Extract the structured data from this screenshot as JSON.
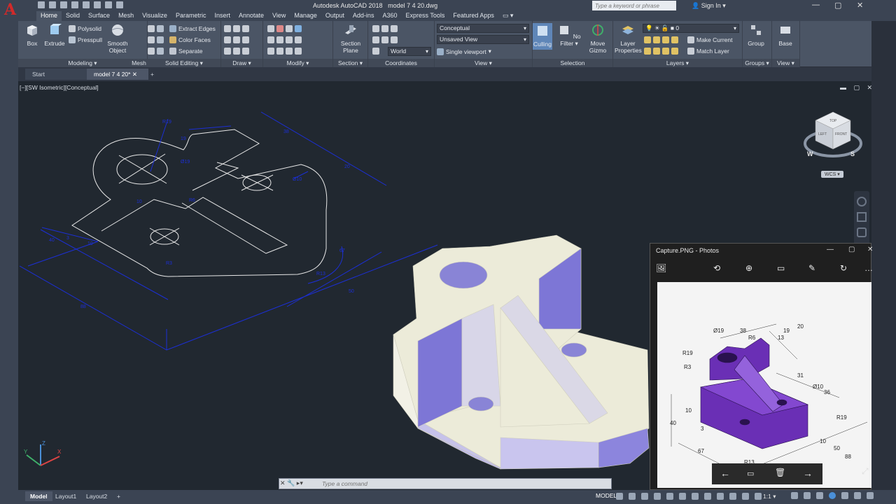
{
  "titlebar": {
    "app_name": "Autodesk AutoCAD 2018",
    "file_name": "model 7 4 20.dwg",
    "search_placeholder": "Type a keyword or phrase",
    "signin": "Sign In"
  },
  "ribbon_tabs": [
    "Home",
    "Solid",
    "Surface",
    "Mesh",
    "Visualize",
    "Parametric",
    "Insert",
    "Annotate",
    "View",
    "Manage",
    "Output",
    "Add-ins",
    "A360",
    "Express Tools",
    "Featured Apps"
  ],
  "panels": {
    "modeling": {
      "title": "Modeling",
      "box": "Box",
      "extrude": "Extrude",
      "polysolid": "Polysolid",
      "presspull": "Presspull",
      "smooth_object_1": "Smooth",
      "smooth_object_2": "Object"
    },
    "mesh": {
      "title": "Mesh"
    },
    "solid_editing": {
      "title": "Solid Editing",
      "extract_edges": "Extract Edges",
      "color_faces": "Color Faces",
      "separate": "Separate"
    },
    "draw": {
      "title": "Draw"
    },
    "modify": {
      "title": "Modify"
    },
    "section": {
      "title": "Section",
      "section_plane_1": "Section",
      "section_plane_2": "Plane"
    },
    "coordinates": {
      "title": "Coordinates",
      "world": "World"
    },
    "view": {
      "title": "View",
      "visual_style": "Conceptual",
      "named_view": "Unsaved View",
      "viewport_config": "Single viewport"
    },
    "selection": {
      "title": "Selection",
      "culling": "Culling",
      "no_filter": "No Filter",
      "move_gizmo_1": "Move",
      "move_gizmo_2": "Gizmo"
    },
    "layers": {
      "title": "Layers",
      "layer_properties_1": "Layer",
      "layer_properties_2": "Properties",
      "current_layer": "0",
      "make_current": "Make Current",
      "match_layer": "Match Layer"
    },
    "groups": {
      "title": "Groups",
      "group": "Group"
    },
    "view2": {
      "title": "View",
      "base": "Base"
    }
  },
  "file_tabs": [
    "Start",
    "model 7 4 20*"
  ],
  "viewport": {
    "label": "[−][SW Isometric][Conceptual]",
    "wcs": "WCS",
    "cube_faces": {
      "top": "TOP",
      "left": "LEFT",
      "front": "FRONT"
    },
    "compass": {
      "w": "W",
      "s": "S"
    },
    "ucs": {
      "x": "X",
      "y": "Y",
      "z": "Z"
    }
  },
  "photos": {
    "title": "Capture.PNG - Photos",
    "dims": [
      "Ø19",
      "38",
      "R6",
      "19",
      "20",
      "13",
      "R19",
      "R3",
      "31",
      "Ø10",
      "36",
      "10",
      "40",
      "3",
      "67",
      "R13",
      "10",
      "R19",
      "50",
      "88"
    ]
  },
  "command": {
    "placeholder": "Type a command"
  },
  "status": {
    "layout_tabs": [
      "Model",
      "Layout1",
      "Layout2"
    ],
    "model": "MODEL",
    "scale": "1:1"
  },
  "colors": {
    "dim_blue": "#1c2fd6",
    "model_face": "#ecebd9",
    "model_side": "#7d76d6",
    "photo_purple": "#6a2fb5"
  }
}
